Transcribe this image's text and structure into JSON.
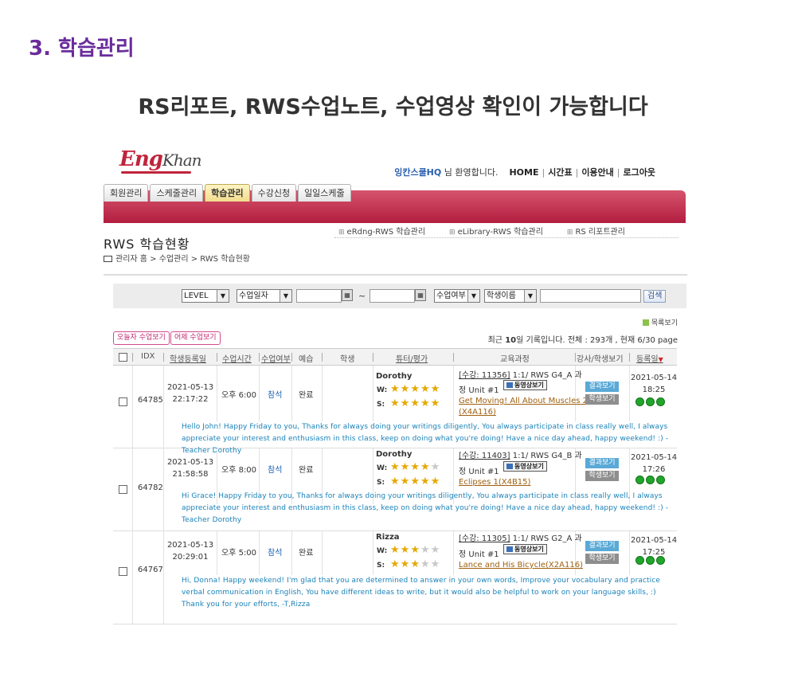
{
  "section_title": "3. 학습관리",
  "subtitle": "RS리포트, RWS수업노트, 수업영상 확인이 가능합니다",
  "app": {
    "logo_main": "Eng",
    "logo_accent": "Khan",
    "topnav": {
      "user": "잉칸스쿨HQ",
      "greeting": "님 환영합니다.",
      "links": [
        "HOME",
        "시간표",
        "이용안내",
        "로그아웃"
      ]
    },
    "tabs": [
      "회원관리",
      "스케줄관리",
      "학습관리",
      "수강신청",
      "일일스케줄"
    ],
    "active_tab": 2,
    "subnav": [
      "eRdng-RWS 학습관리",
      "eLibrary-RWS 학습관리",
      "RS 리포트관리"
    ],
    "page_title": "RWS 학습현황",
    "breadcrumb": "관리자 홈 > 수업관리 > RWS 학습현황",
    "search": {
      "level": "LEVEL",
      "date_type": "수업일자",
      "tilde": "~",
      "status": "수업여부",
      "student": "학생이름",
      "button": "검색"
    },
    "list_view": "목록보기",
    "pills": [
      "오늘자 수업보기",
      "어제 수업보기"
    ],
    "count_prefix": "최근",
    "count_days": "10",
    "count_suffix": "일 기록입니다. 전체 : 293개 , 현재 6/30 page",
    "columns": [
      "IDX",
      "학생등록일",
      "수업시간",
      "수업여부",
      "예습",
      "학생",
      "튜터/평가",
      "교육과정",
      "강사/학생보기",
      "등록일"
    ],
    "rows": [
      {
        "idx": "64785",
        "reg_date": "2021-05-13",
        "reg_time": "22:17:22",
        "class_time": "오후 6:00",
        "attend": "참석",
        "prep": "완료",
        "tutor": "Dorothy",
        "w_label": "W:",
        "s_label": "S:",
        "w_stars": 5,
        "s_stars": 5,
        "course_code": "[수강: 11356]",
        "course_info": "1:1/ RWS G4_A 과",
        "unit": "정 Unit #1",
        "video_btn": "동영상보기",
        "course_name": "Get Moving! All About Muscles 2",
        "course_id": "(X4A116)",
        "result_btn": "결과보기",
        "student_btn": "학생보기",
        "date": "2021-05-14",
        "time": "18:25",
        "comment": "Hello John! Happy Friday to you, Thanks for always doing your writings diligently, You always participate in class really well, I always appreciate your interest and enthusiasm in this class, keep on doing what you're doing! Have a nice day ahead, happy weekend! :) - Teacher Dorothy"
      },
      {
        "idx": "64782",
        "reg_date": "2021-05-13",
        "reg_time": "21:58:58",
        "class_time": "오후 8:00",
        "attend": "참석",
        "prep": "완료",
        "tutor": "Dorothy",
        "w_label": "W:",
        "s_label": "S:",
        "w_stars": 4,
        "s_stars": 5,
        "course_code": "[수강: 11403]",
        "course_info": "1:1/ RWS G4_B 과",
        "unit": "정 Unit #1",
        "video_btn": "동영상보기",
        "course_name": "Eclipses 1(X4B15)",
        "course_id": "",
        "result_btn": "결과보기",
        "student_btn": "학생보기",
        "date": "2021-05-14",
        "time": "17:26",
        "comment": "Hi Grace! Happy Friday to you, Thanks for always doing your writings diligently, You always participate in class really well, I always appreciate your interest and enthusiasm in this class, keep on doing what you're doing! Have a nice day ahead, happy weekend! :) - Teacher Dorothy"
      },
      {
        "idx": "64767",
        "reg_date": "2021-05-13",
        "reg_time": "20:29:01",
        "class_time": "오후 5:00",
        "attend": "참석",
        "prep": "완료",
        "tutor": "Rizza",
        "w_label": "W:",
        "s_label": "S:",
        "w_stars": 3,
        "s_stars": 3,
        "course_code": "[수강: 11305]",
        "course_info": "1:1/ RWS G2_A 과",
        "unit": "정 Unit #1",
        "video_btn": "동영상보기",
        "course_name": "Lance and His Bicycle(X2A116)",
        "course_id": "",
        "result_btn": "결과보기",
        "student_btn": "학생보기",
        "date": "2021-05-14",
        "time": "17:25",
        "comment": "Hi, Donna! Happy weekend! I'm glad that you are determined to answer in your own words, Improve your vocabulary and practice verbal communication in English, You have different ideas to write, but it would also be helpful to work on your language skills, :) Thank you for your efforts, -T,Rizza"
      }
    ]
  }
}
